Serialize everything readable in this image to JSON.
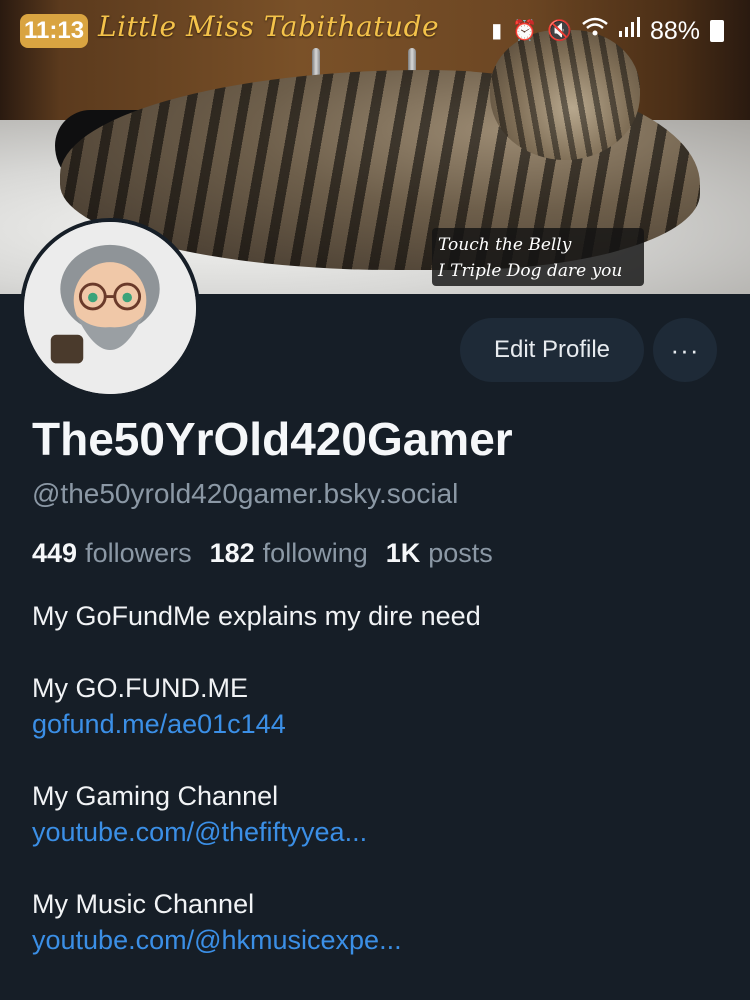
{
  "status_bar": {
    "time": "11:13",
    "battery_percent": "88%",
    "icons": [
      "battery-saver-icon",
      "alarm-icon",
      "mute-icon",
      "wifi-icon",
      "signal-icon",
      "battery-icon"
    ]
  },
  "banner": {
    "title": "Little Miss Tabithatude",
    "caption_line1": "Touch the Belly",
    "caption_line2": "I Triple Dog dare you"
  },
  "actions": {
    "edit_profile_label": "Edit Profile",
    "more_label": "···"
  },
  "profile": {
    "display_name": "The50YrOld420Gamer",
    "handle": "@the50yrold420gamer.bsky.social",
    "stats": {
      "followers_count": "449",
      "followers_label": "followers",
      "following_count": "182",
      "following_label": "following",
      "posts_count": "1K",
      "posts_label": "posts"
    },
    "bio": {
      "line1": "My GoFundMe explains my dire need",
      "gofundme_heading": "My GO.FUND.ME",
      "gofundme_link": "gofund.me/ae01c144",
      "gaming_heading": "My Gaming Channel",
      "gaming_link": "youtube.com/@thefiftyyea...",
      "music_heading": "My Music Channel",
      "music_link": "youtube.com/@hkmusicexpe..."
    }
  },
  "colors": {
    "background": "#161e27",
    "button_bg": "#1e2a37",
    "link": "#3b8fe6",
    "muted": "#8b98a5",
    "banner_title": "#f4c24a"
  }
}
